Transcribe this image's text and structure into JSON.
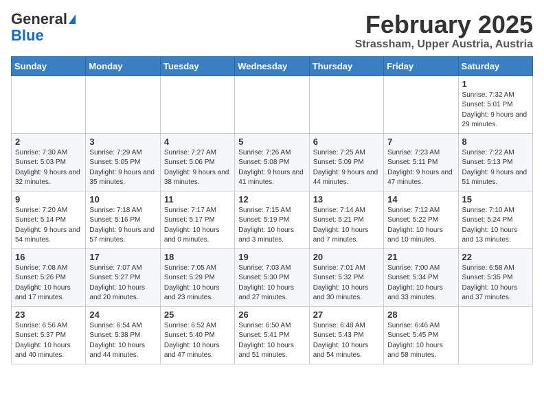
{
  "header": {
    "logo_general": "General",
    "logo_blue": "Blue",
    "month_title": "February 2025",
    "location": "Strassham, Upper Austria, Austria"
  },
  "weekdays": [
    "Sunday",
    "Monday",
    "Tuesday",
    "Wednesday",
    "Thursday",
    "Friday",
    "Saturday"
  ],
  "weeks": [
    [
      {
        "day": null
      },
      {
        "day": null
      },
      {
        "day": null
      },
      {
        "day": null
      },
      {
        "day": null
      },
      {
        "day": null
      },
      {
        "day": "1",
        "info": "Sunrise: 7:32 AM\nSunset: 5:01 PM\nDaylight: 9 hours and 29 minutes."
      }
    ],
    [
      {
        "day": "2",
        "info": "Sunrise: 7:30 AM\nSunset: 5:03 PM\nDaylight: 9 hours and 32 minutes."
      },
      {
        "day": "3",
        "info": "Sunrise: 7:29 AM\nSunset: 5:05 PM\nDaylight: 9 hours and 35 minutes."
      },
      {
        "day": "4",
        "info": "Sunrise: 7:27 AM\nSunset: 5:06 PM\nDaylight: 9 hours and 38 minutes."
      },
      {
        "day": "5",
        "info": "Sunrise: 7:26 AM\nSunset: 5:08 PM\nDaylight: 9 hours and 41 minutes."
      },
      {
        "day": "6",
        "info": "Sunrise: 7:25 AM\nSunset: 5:09 PM\nDaylight: 9 hours and 44 minutes."
      },
      {
        "day": "7",
        "info": "Sunrise: 7:23 AM\nSunset: 5:11 PM\nDaylight: 9 hours and 47 minutes."
      },
      {
        "day": "8",
        "info": "Sunrise: 7:22 AM\nSunset: 5:13 PM\nDaylight: 9 hours and 51 minutes."
      }
    ],
    [
      {
        "day": "9",
        "info": "Sunrise: 7:20 AM\nSunset: 5:14 PM\nDaylight: 9 hours and 54 minutes."
      },
      {
        "day": "10",
        "info": "Sunrise: 7:18 AM\nSunset: 5:16 PM\nDaylight: 9 hours and 57 minutes."
      },
      {
        "day": "11",
        "info": "Sunrise: 7:17 AM\nSunset: 5:17 PM\nDaylight: 10 hours and 0 minutes."
      },
      {
        "day": "12",
        "info": "Sunrise: 7:15 AM\nSunset: 5:19 PM\nDaylight: 10 hours and 3 minutes."
      },
      {
        "day": "13",
        "info": "Sunrise: 7:14 AM\nSunset: 5:21 PM\nDaylight: 10 hours and 7 minutes."
      },
      {
        "day": "14",
        "info": "Sunrise: 7:12 AM\nSunset: 5:22 PM\nDaylight: 10 hours and 10 minutes."
      },
      {
        "day": "15",
        "info": "Sunrise: 7:10 AM\nSunset: 5:24 PM\nDaylight: 10 hours and 13 minutes."
      }
    ],
    [
      {
        "day": "16",
        "info": "Sunrise: 7:08 AM\nSunset: 5:26 PM\nDaylight: 10 hours and 17 minutes."
      },
      {
        "day": "17",
        "info": "Sunrise: 7:07 AM\nSunset: 5:27 PM\nDaylight: 10 hours and 20 minutes."
      },
      {
        "day": "18",
        "info": "Sunrise: 7:05 AM\nSunset: 5:29 PM\nDaylight: 10 hours and 23 minutes."
      },
      {
        "day": "19",
        "info": "Sunrise: 7:03 AM\nSunset: 5:30 PM\nDaylight: 10 hours and 27 minutes."
      },
      {
        "day": "20",
        "info": "Sunrise: 7:01 AM\nSunset: 5:32 PM\nDaylight: 10 hours and 30 minutes."
      },
      {
        "day": "21",
        "info": "Sunrise: 7:00 AM\nSunset: 5:34 PM\nDaylight: 10 hours and 33 minutes."
      },
      {
        "day": "22",
        "info": "Sunrise: 6:58 AM\nSunset: 5:35 PM\nDaylight: 10 hours and 37 minutes."
      }
    ],
    [
      {
        "day": "23",
        "info": "Sunrise: 6:56 AM\nSunset: 5:37 PM\nDaylight: 10 hours and 40 minutes."
      },
      {
        "day": "24",
        "info": "Sunrise: 6:54 AM\nSunset: 5:38 PM\nDaylight: 10 hours and 44 minutes."
      },
      {
        "day": "25",
        "info": "Sunrise: 6:52 AM\nSunset: 5:40 PM\nDaylight: 10 hours and 47 minutes."
      },
      {
        "day": "26",
        "info": "Sunrise: 6:50 AM\nSunset: 5:41 PM\nDaylight: 10 hours and 51 minutes."
      },
      {
        "day": "27",
        "info": "Sunrise: 6:48 AM\nSunset: 5:43 PM\nDaylight: 10 hours and 54 minutes."
      },
      {
        "day": "28",
        "info": "Sunrise: 6:46 AM\nSunset: 5:45 PM\nDaylight: 10 hours and 58 minutes."
      },
      {
        "day": null
      }
    ]
  ]
}
